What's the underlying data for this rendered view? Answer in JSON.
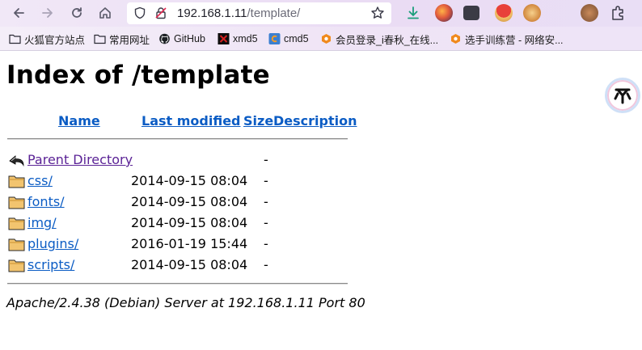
{
  "browser": {
    "url_host": "192.168.1.11",
    "url_path": "/template/",
    "bookmarks": [
      {
        "label": "火狐官方站点",
        "icon": "folder-icon"
      },
      {
        "label": "常用网址",
        "icon": "folder-icon"
      },
      {
        "label": "GitHub",
        "icon": "github-icon"
      },
      {
        "label": "xmd5",
        "icon": "xmd5-icon"
      },
      {
        "label": "cmd5",
        "icon": "cmd5-icon"
      },
      {
        "label": "会员登录_i春秋_在线...",
        "icon": "ichunqiu-icon"
      },
      {
        "label": "选手训练营 - 网络安...",
        "icon": "ichunqiu-icon"
      }
    ]
  },
  "page": {
    "title": "Index of /template",
    "columns": {
      "name": "Name",
      "last_modified": "Last modified",
      "size": "Size",
      "description": "Description"
    },
    "parent": {
      "name": "Parent Directory",
      "size": "-"
    },
    "entries": [
      {
        "name": "css/",
        "modified": "2014-09-15 08:04",
        "size": "-"
      },
      {
        "name": "fonts/",
        "modified": "2014-09-15 08:04",
        "size": "-"
      },
      {
        "name": "img/",
        "modified": "2014-09-15 08:04",
        "size": "-"
      },
      {
        "name": "plugins/",
        "modified": "2016-01-19 15:44",
        "size": "-"
      },
      {
        "name": "scripts/",
        "modified": "2014-09-15 08:04",
        "size": "-"
      }
    ],
    "address": "Apache/2.4.38 (Debian) Server at 192.168.1.11 Port 80"
  },
  "colors": {
    "link": "#0b5cc4",
    "visited_link": "#5b2396",
    "toolbar_tint": "#eadcf4"
  }
}
